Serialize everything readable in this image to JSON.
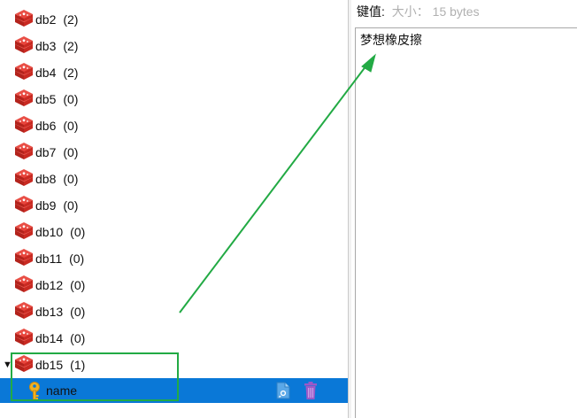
{
  "tree": {
    "databases": [
      {
        "name": "db2",
        "count": "(2)"
      },
      {
        "name": "db3",
        "count": "(2)"
      },
      {
        "name": "db4",
        "count": "(2)"
      },
      {
        "name": "db5",
        "count": "(0)"
      },
      {
        "name": "db6",
        "count": "(0)"
      },
      {
        "name": "db7",
        "count": "(0)"
      },
      {
        "name": "db8",
        "count": "(0)"
      },
      {
        "name": "db9",
        "count": "(0)"
      },
      {
        "name": "db10",
        "count": "(0)"
      },
      {
        "name": "db11",
        "count": "(0)"
      },
      {
        "name": "db12",
        "count": "(0)"
      },
      {
        "name": "db13",
        "count": "(0)"
      },
      {
        "name": "db14",
        "count": "(0)"
      },
      {
        "name": "db15",
        "count": "(1)",
        "expanded": true
      }
    ],
    "expand_glyph": "▼",
    "key_item": {
      "name": "name",
      "selected": true,
      "icon": "key-icon"
    },
    "row_actions": [
      {
        "icon": "copy-document-icon"
      },
      {
        "icon": "trash-icon"
      }
    ]
  },
  "value_panel": {
    "key_label": "键值:",
    "size_label": "大小： 15 bytes",
    "value": "梦想橡皮擦"
  },
  "colors": {
    "selection": "#0a78d7",
    "db_icon_red": "#d9302a",
    "annotation_green": "#22aa44",
    "key_gold": "#f0b020",
    "trash_purple": "#9b59c8"
  }
}
